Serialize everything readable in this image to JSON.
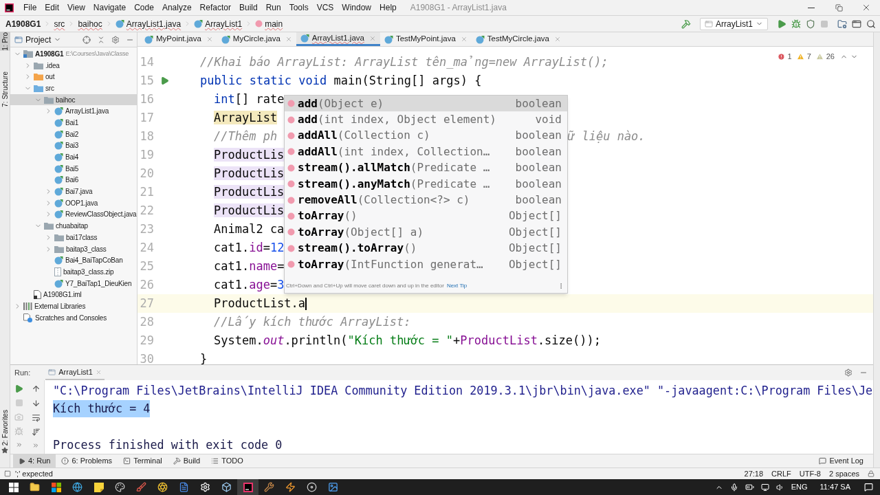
{
  "menu_bar": {
    "items": [
      "File",
      "Edit",
      "View",
      "Navigate",
      "Code",
      "Analyze",
      "Refactor",
      "Build",
      "Run",
      "Tools",
      "VCS",
      "Window",
      "Help"
    ],
    "title": "A1908G1 - ArrayList1.java"
  },
  "breadcrumbs": [
    {
      "label": "A1908G1",
      "kind": "project"
    },
    {
      "label": "src",
      "kind": "folder"
    },
    {
      "label": "baihoc",
      "kind": "folder"
    },
    {
      "label": "ArrayList1.java",
      "kind": "class"
    },
    {
      "label": "ArrayList1",
      "kind": "class"
    },
    {
      "label": "main",
      "kind": "method"
    }
  ],
  "run_config": "ArrayList1",
  "tool_strip": [
    {
      "label": "1: Pro",
      "selected": true
    },
    {
      "label": "7: Structure",
      "selected": false
    }
  ],
  "favorites": "2: Favorites",
  "project_panel": {
    "title": "Project",
    "tree": [
      {
        "label": "A1908G1",
        "detail": "E:\\Courses\\Java\\Classe",
        "kind": "module",
        "expanded": true,
        "selected": false,
        "children": [
          {
            "label": ".idea",
            "kind": "folder",
            "expanded": false,
            "selected": false
          },
          {
            "label": "out",
            "kind": "excluded",
            "expanded": false,
            "selected": false
          },
          {
            "label": "src",
            "kind": "source",
            "expanded": true,
            "selected": false,
            "children": [
              {
                "label": "baihoc",
                "kind": "package",
                "expanded": true,
                "selected": true,
                "children": [
                  {
                    "label": "ArrayList1.java",
                    "kind": "class",
                    "expanded": false,
                    "selected": false
                  },
                  {
                    "label": "Bai1",
                    "kind": "class",
                    "selected": false
                  },
                  {
                    "label": "Bai2",
                    "kind": "class",
                    "selected": false
                  },
                  {
                    "label": "Bai3",
                    "kind": "class",
                    "selected": false
                  },
                  {
                    "label": "Bai4",
                    "kind": "class",
                    "selected": false
                  },
                  {
                    "label": "Bai5",
                    "kind": "class",
                    "selected": false
                  },
                  {
                    "label": "Bai6",
                    "kind": "class",
                    "selected": false
                  },
                  {
                    "label": "Bai7.java",
                    "kind": "class",
                    "expanded": false,
                    "selected": false
                  },
                  {
                    "label": "OOP1.java",
                    "kind": "class",
                    "expanded": false,
                    "selected": false
                  },
                  {
                    "label": "ReviewClassObject.java",
                    "kind": "class",
                    "expanded": false,
                    "selected": false
                  }
                ]
              },
              {
                "label": "chuabaitap",
                "kind": "package",
                "expanded": true,
                "selected": false,
                "children": [
                  {
                    "label": "bai17class",
                    "kind": "package",
                    "expanded": false,
                    "selected": false
                  },
                  {
                    "label": "baitap3_class",
                    "kind": "package",
                    "expanded": false,
                    "selected": false
                  },
                  {
                    "label": "Bai4_BaiTapCoBan",
                    "kind": "class",
                    "selected": false
                  },
                  {
                    "label": "baitap3_class.zip",
                    "kind": "zip",
                    "selected": false
                  },
                  {
                    "label": "Y7_BaiTap1_DieuKien",
                    "kind": "class",
                    "selected": false
                  }
                ]
              }
            ]
          },
          {
            "label": "A1908G1.iml",
            "kind": "iml",
            "selected": false
          }
        ]
      },
      {
        "label": "External Libraries",
        "kind": "libraries",
        "expanded": false,
        "selected": false
      },
      {
        "label": "Scratches and Consoles",
        "kind": "scratches",
        "selected": false
      }
    ]
  },
  "editor": {
    "tabs": [
      {
        "label": "MyPoint.java",
        "selected": false
      },
      {
        "label": "MyCircle.java",
        "selected": false
      },
      {
        "label": "ArrayList1.java",
        "selected": true
      },
      {
        "label": "TestMyPoint.java",
        "selected": false
      },
      {
        "label": "TestMyCircle.java",
        "selected": false
      }
    ],
    "inspections": {
      "errors": "1",
      "warnings": "7",
      "weak_warnings": "26"
    },
    "lines": [
      {
        "number": "14",
        "indent": false,
        "current": false,
        "tokens": [
          {
            "text": "//Khai báo ArrayList: ArrayList tên_mảng=new ArrayList();",
            "kind": "comment"
          }
        ]
      },
      {
        "number": "15",
        "indent": false,
        "current": false,
        "run_marker": true,
        "tokens": [
          {
            "text": "public static void",
            "kind": "keyword"
          },
          {
            "text": " main(String[] args) {",
            "kind": "plain"
          }
        ]
      },
      {
        "number": "16",
        "indent": true,
        "current": false,
        "tokens": [
          {
            "text": "int",
            "kind": "keyword"
          },
          {
            "text": "[] rate",
            "kind": "plain"
          }
        ]
      },
      {
        "number": "17",
        "indent": true,
        "current": false,
        "tokens": [
          {
            "text": "ArrayList",
            "kind": "warning"
          }
        ]
      },
      {
        "number": "18",
        "indent": true,
        "current": false,
        "tokens": [
          {
            "text": "//Thêm ph",
            "kind": "comment"
          }
        ],
        "tail": {
          "text": "ữ liệu nào.",
          "kind": "comment"
        }
      },
      {
        "number": "19",
        "indent": true,
        "current": false,
        "tokens": [
          {
            "text": "ProductLis",
            "kind": "usage"
          }
        ]
      },
      {
        "number": "20",
        "indent": true,
        "current": false,
        "tokens": [
          {
            "text": "ProductLis",
            "kind": "usage"
          }
        ]
      },
      {
        "number": "21",
        "indent": true,
        "current": false,
        "tokens": [
          {
            "text": "ProductLis",
            "kind": "usage"
          }
        ]
      },
      {
        "number": "22",
        "indent": true,
        "current": false,
        "tokens": [
          {
            "text": "ProductLis",
            "kind": "usage"
          }
        ]
      },
      {
        "number": "23",
        "indent": true,
        "current": false,
        "tokens": [
          {
            "text": "Animal2 ca",
            "kind": "plain"
          }
        ]
      },
      {
        "number": "24",
        "indent": true,
        "current": false,
        "tokens": [
          {
            "text": "cat1.",
            "kind": "plain"
          },
          {
            "text": "id",
            "kind": "field"
          },
          {
            "text": "=",
            "kind": "plain"
          },
          {
            "text": "12",
            "kind": "number"
          }
        ]
      },
      {
        "number": "25",
        "indent": true,
        "current": false,
        "tokens": [
          {
            "text": "cat1.",
            "kind": "plain"
          },
          {
            "text": "name",
            "kind": "field"
          },
          {
            "text": "=",
            "kind": "plain"
          }
        ]
      },
      {
        "number": "26",
        "indent": true,
        "current": false,
        "tokens": [
          {
            "text": "cat1.",
            "kind": "plain"
          },
          {
            "text": "age",
            "kind": "field"
          },
          {
            "text": "=",
            "kind": "plain"
          },
          {
            "text": "3",
            "kind": "number"
          }
        ]
      },
      {
        "number": "27",
        "indent": true,
        "current": true,
        "tokens": [
          {
            "text": "ProductList.a",
            "kind": "plain"
          }
        ]
      },
      {
        "number": "28",
        "indent": true,
        "current": false,
        "tokens": [
          {
            "text": "//Lấy kích thước ArrayList:",
            "kind": "comment"
          }
        ]
      },
      {
        "number": "29",
        "indent": true,
        "current": false,
        "tokens": [
          {
            "text": "System.",
            "kind": "plain"
          },
          {
            "text": "out",
            "kind": "static"
          },
          {
            "text": ".println(",
            "kind": "plain"
          },
          {
            "text": "\"Kích thước = \"",
            "kind": "string"
          },
          {
            "text": "+",
            "kind": "plain"
          },
          {
            "text": "ProductList",
            "kind": "field"
          },
          {
            "text": ".size());",
            "kind": "plain"
          }
        ]
      },
      {
        "number": "30",
        "indent": false,
        "current": false,
        "tokens": [
          {
            "text": "}",
            "kind": "plain"
          }
        ]
      }
    ],
    "completion": {
      "items": [
        {
          "name": "add",
          "params": "(Object e)",
          "type": "boolean",
          "selected": true
        },
        {
          "name": "add",
          "params": "(int index, Object element)",
          "type": "void",
          "selected": false
        },
        {
          "name": "addAll",
          "params": "(Collection c)",
          "type": "boolean",
          "selected": false
        },
        {
          "name": "addAll",
          "params": "(int index, Collection…",
          "type": "boolean",
          "selected": false
        },
        {
          "name": "stream().allMatch",
          "params": "(Predicate …",
          "type": "boolean",
          "selected": false
        },
        {
          "name": "stream().anyMatch",
          "params": "(Predicate …",
          "type": "boolean",
          "selected": false
        },
        {
          "name": "removeAll",
          "params": "(Collection<?> c)",
          "type": "boolean",
          "selected": false
        },
        {
          "name": "toArray",
          "params": "()",
          "type": "Object[]",
          "selected": false
        },
        {
          "name": "toArray",
          "params": "(Object[] a)",
          "type": "Object[]",
          "selected": false
        },
        {
          "name": "stream().toArray",
          "params": "()",
          "type": "Object[]",
          "selected": false
        },
        {
          "name": "toArray",
          "params": "(IntFunction generat…",
          "type": "Object[]",
          "selected": false
        }
      ],
      "hint": "Ctrl+Down and Ctrl+Up will move caret down and up in the editor",
      "hint_link": "Next Tip"
    }
  },
  "run_panel": {
    "title": "Run:",
    "tab": "ArrayList1",
    "console": [
      {
        "text": "\"C:\\Program Files\\JetBrains\\IntelliJ IDEA Community Edition 2019.3.1\\jbr\\bin\\java.exe\" \"-javaagent:C:\\Program Files\\Je",
        "kind": "command",
        "selected": false
      },
      {
        "text": "Kích thước = 4",
        "kind": "output",
        "selected": true
      },
      {
        "text": "Process finished with exit code 0",
        "kind": "exit",
        "selected": false
      }
    ]
  },
  "tool_tabs": [
    {
      "label": "4: Run",
      "kind": "run",
      "selected": true
    },
    {
      "label": "6: Problems",
      "kind": "problems",
      "selected": false
    },
    {
      "label": "Terminal",
      "kind": "terminal",
      "selected": false
    },
    {
      "label": "Build",
      "kind": "build",
      "selected": false
    },
    {
      "label": "TODO",
      "kind": "todo",
      "selected": false
    }
  ],
  "event_log": "Event Log",
  "status_bar": {
    "message": "';' expected",
    "position": "27:18",
    "line_separator": "CRLF",
    "encoding": "UTF-8",
    "indent": "2 spaces"
  },
  "taskbar": {
    "apps": [
      {
        "kind": "start",
        "selected": false
      },
      {
        "kind": "explorer",
        "selected": false
      },
      {
        "kind": "store",
        "selected": false
      },
      {
        "kind": "browser",
        "selected": false
      },
      {
        "kind": "notes",
        "selected": false
      },
      {
        "kind": "paint3d",
        "selected": false
      },
      {
        "kind": "paint",
        "selected": false
      },
      {
        "kind": "chrome",
        "selected": false
      },
      {
        "kind": "word",
        "selected": false
      },
      {
        "kind": "settings",
        "selected": false
      },
      {
        "kind": "cube",
        "selected": false
      },
      {
        "kind": "ide",
        "selected": true
      },
      {
        "kind": "tool",
        "selected": false
      },
      {
        "kind": "sublime",
        "selected": false
      },
      {
        "kind": "obs",
        "selected": false
      },
      {
        "kind": "photoshop",
        "selected": false
      }
    ],
    "language": "ENG",
    "clock": "11:47 SA"
  }
}
